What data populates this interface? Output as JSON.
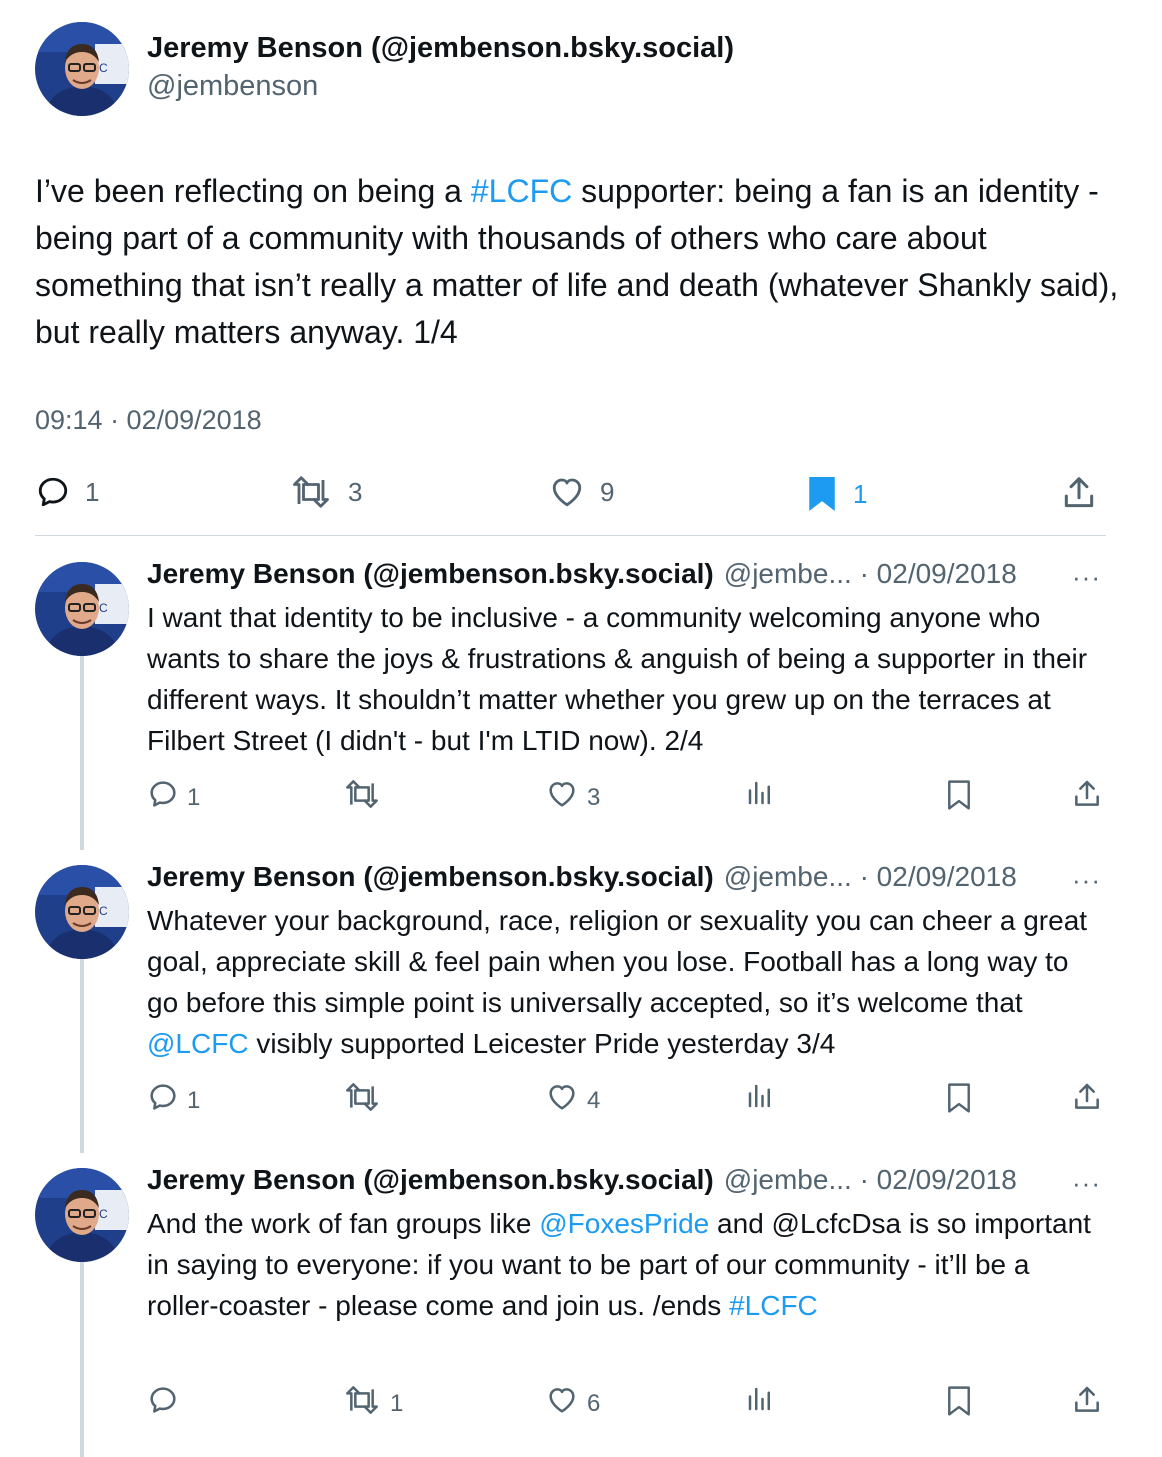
{
  "main": {
    "name": "Jeremy Benson (@jembenson.bsky.social)",
    "handle": "@jembenson",
    "text_parts": [
      {
        "text": "I’ve been reflecting on being a "
      },
      {
        "text": "#LCFC",
        "link": true
      },
      {
        "text": " supporter: being a fan is an identity - being part of a community with thousands of others who care about something that isn’t really a matter of life and death (whatever Shankly said), but really matters anyway. 1/4"
      }
    ],
    "timestamp": "09:14 · 02/09/2018",
    "counts": {
      "replies": "1",
      "reposts": "3",
      "likes": "9",
      "bookmarks": "1"
    },
    "bookmark_color": "#1d9bf0"
  },
  "replies": [
    {
      "name": "Jeremy Benson (@jembenson.bsky.social)",
      "handle_date": "@jembe... · 02/09/2018",
      "text_parts": [
        {
          "text": "I want that identity to be inclusive - a community welcoming anyone who wants to share the joys & frustrations & anguish of being a supporter in their different ways. It shouldn’t matter whether you grew up on the terraces at Filbert Street (I didn't - but I'm LTID now). 2/4"
        }
      ],
      "counts": {
        "replies": "1",
        "reposts": "",
        "likes": "3"
      }
    },
    {
      "name": "Jeremy Benson (@jembenson.bsky.social)",
      "handle_date": "@jembe... · 02/09/2018",
      "text_parts": [
        {
          "text": "Whatever your background, race, religion or sexuality you can cheer a great goal, appreciate skill & feel pain when you lose. Football has a long way to go before this simple point is universally accepted, so it’s welcome that "
        },
        {
          "text": "@LCFC",
          "link": true
        },
        {
          "text": " visibly supported Leicester Pride yesterday 3/4"
        }
      ],
      "counts": {
        "replies": "1",
        "reposts": "",
        "likes": "4"
      }
    },
    {
      "name": "Jeremy Benson (@jembenson.bsky.social)",
      "handle_date": "@jembe... · 02/09/2018",
      "text_parts": [
        {
          "text": "And the work of fan groups like "
        },
        {
          "text": "@FoxesPride",
          "link": true
        },
        {
          "text": " and @LcfcDsa is so important in saying to everyone: if you want to be part of our community - it’ll be a roller-coaster - please come and join us. /ends "
        },
        {
          "text": "#LCFC",
          "link": true
        }
      ],
      "counts": {
        "replies": "",
        "reposts": "1",
        "likes": "6"
      }
    }
  ],
  "more_label": "···",
  "colors": {
    "accent": "#1d9bf0",
    "muted": "#536471",
    "divider": "#cfd9de"
  },
  "icons": [
    "reply-icon",
    "repost-icon",
    "like-icon",
    "bookmark-icon",
    "share-icon",
    "views-icon",
    "more-icon"
  ]
}
